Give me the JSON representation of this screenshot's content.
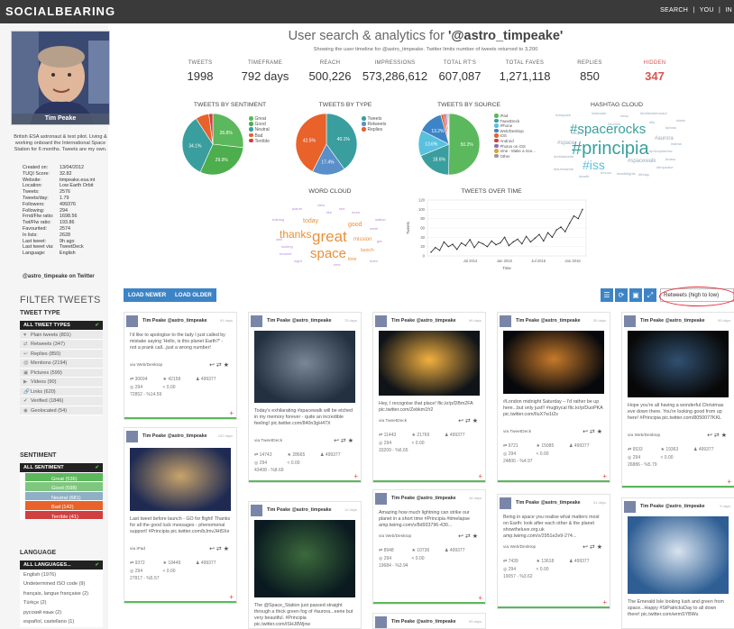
{
  "nav": {
    "logo": "SOCIALBEARING",
    "links": [
      "SEARCH",
      "|",
      "YOU",
      "|",
      "IN"
    ]
  },
  "profile": {
    "name": "Tim Peake",
    "bio": "British ESA astronaut & test pilot. Living & working onboard the International Space Station for 6 months. Tweets are my own.",
    "stats": [
      [
        "Created on:",
        "13/04/2012"
      ],
      [
        "TUQI Score:",
        "32.82"
      ],
      [
        "Website:",
        "timpeake.esa.int"
      ],
      [
        "Location:",
        "Low Earth Orbit"
      ],
      [
        "Tweets:",
        "2576"
      ],
      [
        "Tweets/day:",
        "1.79"
      ],
      [
        "Followers:",
        "499376"
      ],
      [
        "Following:",
        "294"
      ],
      [
        "Frnd/Flw ratio:",
        "1698.56"
      ],
      [
        "Twt/Flw ratio:",
        "193.86"
      ],
      [
        "Favourited:",
        "2574"
      ],
      [
        "In lists:",
        "2628"
      ],
      [
        "Last tweet:",
        "9h ago"
      ],
      [
        "Last tweet via:",
        "TweetDeck"
      ],
      [
        "Language:",
        "English"
      ]
    ],
    "handle_line": "@astro_timpeake on Twitter"
  },
  "filter": {
    "heading": "FILTER TWEETS",
    "type_title": "TWEET TYPE",
    "type": [
      "ALL TWEET TYPES",
      "Plain tweets (801)",
      "Retweets (347)",
      "Replies (850)",
      "Mentions (2194)",
      "Pictures (599)",
      "Videos (90)",
      "Links (620)",
      "Verified (1846)",
      "Geolocated (54)"
    ],
    "sent_title": "SENTIMENT",
    "sent": [
      "ALL SENTIMENT",
      "Great (536)",
      "Good (598)",
      "Neutral (681)",
      "Bad (142)",
      "Terrible (41)"
    ],
    "lang_title": "LANGUAGE",
    "lang": [
      "ALL LANGUAGES...",
      "English (1976)",
      "Undetermined ISO code (9)",
      "français, langue française (2)",
      "Türkçe (2)",
      "русский язык (2)",
      "español, castellano (1)"
    ]
  },
  "header": {
    "title_prefix": "User search & analytics for ",
    "title_user": "'@astro_timpeake'",
    "subtitle": "Showing the user timeline for @astro_timpeake. Twitter limits number of tweets returned to 3,200"
  },
  "metrics": [
    {
      "label": "TWEETS",
      "value": "1998"
    },
    {
      "label": "TIMEFRAME",
      "value": "792 days"
    },
    {
      "label": "REACH",
      "value": "500,226"
    },
    {
      "label": "IMPRESSIONS",
      "value": "573,286,612"
    },
    {
      "label": "TOTAL RT'S",
      "value": "607,087"
    },
    {
      "label": "TOTAL FAVES",
      "value": "1,271,118"
    },
    {
      "label": "REPLIES",
      "value": "850"
    },
    {
      "label": "HIDDEN",
      "value": "347"
    }
  ],
  "colors": {
    "accent": "#3d84c6",
    "hidden": "#d9534f",
    "great": "#5cb85c",
    "good": "#4cae4c",
    "neutral": "#3a9e9e",
    "bad": "#e8622a",
    "terrible": "#d04040"
  },
  "panels": {
    "sentiment": "TWEETS BY SENTIMENT",
    "type": "TWEETS BY TYPE",
    "source": "TWEETS BY SOURCE",
    "hashtag": "HASHTAG CLOUD",
    "word": "WORD CLOUD",
    "time": "TWEETS OVER TIME"
  },
  "chart_data": [
    {
      "type": "pie",
      "title": "TWEETS BY SENTIMENT",
      "labels": [
        "Great",
        "Good",
        "Neutral",
        "Bad",
        "Terrible"
      ],
      "values": [
        26.8,
        29.9,
        34.1,
        7.1,
        2.1
      ],
      "data_labels": [
        "26.8%",
        "29.9%",
        "34.1%"
      ],
      "colors": [
        "#5cb85c",
        "#4cae4c",
        "#3a9e9e",
        "#e8622a",
        "#d04040"
      ]
    },
    {
      "type": "pie",
      "title": "TWEETS BY TYPE",
      "labels": [
        "Tweets",
        "Retweets",
        "Replies"
      ],
      "values": [
        40.1,
        17.4,
        42.5
      ],
      "data_labels": [
        "40.1%",
        "17.4%",
        "42.5%"
      ],
      "colors": [
        "#3a9e9e",
        "#5b8fc9",
        "#e8622a"
      ]
    },
    {
      "type": "pie",
      "title": "TWEETS BY SOURCE",
      "labels": [
        "iPad",
        "TweetDeck",
        "iPhone",
        "Web/Desktop",
        "iOS",
        "Android",
        "Photos on iOS",
        "Vine - Make a Sce...",
        "Other"
      ],
      "values": [
        50.2,
        18.6,
        13.6,
        13.2,
        1.5,
        1.0,
        0.8,
        0.6,
        0.5
      ],
      "data_labels": [
        "50.2%",
        "18.6%",
        "13.6%",
        "13.2%"
      ],
      "colors": [
        "#5cb85c",
        "#3a9e9e",
        "#5bc0de",
        "#3d84c6",
        "#e8622a",
        "#d04040",
        "#8a6fb4",
        "#d9a440",
        "#999999"
      ]
    },
    {
      "type": "line",
      "title": "TWEETS OVER TIME",
      "ylabel": "Tweets",
      "xlabel": "Time",
      "yticks": [
        0,
        20,
        40,
        60,
        80,
        100,
        120
      ],
      "ylim": [
        0,
        120
      ],
      "xticks": [
        "Jul 2014",
        "Jan 2015",
        "Jul 2015",
        "Jan 2016"
      ],
      "values": [
        8,
        18,
        12,
        30,
        20,
        25,
        14,
        28,
        22,
        35,
        18,
        30,
        26,
        20,
        32,
        24,
        28,
        40,
        22,
        30,
        36,
        26,
        42,
        30,
        38,
        46,
        32,
        50,
        40,
        56,
        62,
        52,
        70,
        86,
        80,
        100
      ]
    }
  ],
  "hashtags": [
    {
      "t": "#spacerocks",
      "s": 15,
      "c": "#3a9e9e"
    },
    {
      "t": "#principia",
      "s": 20,
      "c": "#3a9e9e"
    },
    {
      "t": "#iss",
      "s": 14,
      "c": "#5bc0de"
    },
    {
      "t": "#aurora",
      "s": 6,
      "c": "#9ab"
    },
    {
      "t": "#space",
      "s": 6,
      "c": "#9ab"
    },
    {
      "t": "#spacewalk",
      "s": 6,
      "c": "#9ab"
    },
    {
      "t": "#esa",
      "s": 4,
      "c": "#9ab"
    },
    {
      "t": "#britishastronaut",
      "s": 4,
      "c": "#9ab"
    },
    {
      "t": "#orbitalearth",
      "s": 4,
      "c": "#9ab"
    },
    {
      "t": "#principiacrew",
      "s": 4,
      "c": "#9ab"
    },
    {
      "t": "#nasa",
      "s": 4,
      "c": "#9ab"
    },
    {
      "t": "#timpeake",
      "s": 4,
      "c": "#9ab"
    },
    {
      "t": "#friday",
      "s": 4,
      "c": "#9ab"
    },
    {
      "t": "#astrolab",
      "s": 4,
      "c": "#9ab"
    },
    {
      "t": "#earthlights",
      "s": 4,
      "c": "#9ab"
    },
    {
      "t": "#stinta",
      "s": 4,
      "c": "#9ab"
    },
    {
      "t": "#soyuz",
      "s": 4,
      "c": "#9ab"
    },
    {
      "t": "#bluemarble",
      "s": 4,
      "c": "#9ab"
    },
    {
      "t": "#photo",
      "s": 4,
      "c": "#9ab"
    },
    {
      "t": "#dark",
      "s": 4,
      "c": "#9ab"
    },
    {
      "t": "#sunset",
      "s": 4,
      "c": "#9ab"
    },
    {
      "t": "#ukspace",
      "s": 4,
      "c": "#9ab"
    },
    {
      "t": "#moon",
      "s": 4,
      "c": "#9ab"
    },
    {
      "t": "#earth",
      "s": 4,
      "c": "#9ab"
    },
    {
      "t": "#fly",
      "s": 4,
      "c": "#9ab"
    }
  ],
  "words": [
    {
      "t": "great",
      "s": 17,
      "c": "#e8913a"
    },
    {
      "t": "space",
      "s": 15,
      "c": "#e8913a"
    },
    {
      "t": "thanks",
      "s": 12,
      "c": "#e8913a"
    },
    {
      "t": "today",
      "s": 7,
      "c": "#e8913a"
    },
    {
      "t": "good",
      "s": 7,
      "c": "#e8913a"
    },
    {
      "t": "mission",
      "s": 6,
      "c": "#e8913a"
    },
    {
      "t": "launch",
      "s": 5,
      "c": "#e8913a"
    },
    {
      "t": "time",
      "s": 5,
      "c": "#e8913a"
    },
    {
      "t": "more",
      "s": 4,
      "c": "#b58adf"
    },
    {
      "t": "like",
      "s": 4,
      "c": "#b58adf"
    },
    {
      "t": "looking",
      "s": 4,
      "c": "#b58adf"
    },
    {
      "t": "forward",
      "s": 4,
      "c": "#b58adf"
    },
    {
      "t": "training",
      "s": 4,
      "c": "#b58adf"
    },
    {
      "t": "planet",
      "s": 4,
      "c": "#b58adf"
    },
    {
      "t": "earth",
      "s": 4,
      "c": "#b58adf"
    },
    {
      "t": "new",
      "s": 4,
      "c": "#b58adf"
    },
    {
      "t": "get",
      "s": 4,
      "c": "#b58adf"
    },
    {
      "t": "well",
      "s": 4,
      "c": "#b58adf"
    },
    {
      "t": "view",
      "s": 4,
      "c": "#b58adf"
    },
    {
      "t": "night",
      "s": 4,
      "c": "#b58adf"
    },
    {
      "t": "team",
      "s": 4,
      "c": "#b58adf"
    },
    {
      "t": "see",
      "s": 4,
      "c": "#b58adf"
    },
    {
      "t": "station",
      "s": 4,
      "c": "#b58adf"
    }
  ],
  "toolbar": {
    "newer": "LOAD NEWER",
    "older": "LOAD OLDER",
    "sort": "Retweets (high to low)",
    "icons": [
      "☰",
      "⟳",
      "▣",
      "⤢"
    ]
  },
  "tweets": [
    {
      "user": "Tim Peake @astro_timpeake",
      "days": "91 days",
      "text": "I'd like to apologise to the lady I just called by mistake saying 'Hello, is this planet Earth?' - not a prank call...just a wrong number!",
      "via": "via Web/Desktop",
      "rt": "30694",
      "fav": "42158",
      "fol": "499377",
      "fr": "294",
      "ratio": "0.00",
      "imp": "72852 - %14.59"
    },
    {
      "user": "Tim Peake @astro_timpeake",
      "days": "102 days",
      "text": "Last tweet before launch - GO for flight! Thanks for all the good luck messages - phenomenal support! #Principia pic.twitter.com/bJmvJHt5Xe",
      "via": "via iPad",
      "rt": "9372",
      "fav": "18449",
      "fol": "499377",
      "fr": "294",
      "ratio": "0.00",
      "imp": "27817 - %5.57"
    },
    {
      "user": "Tim Peake @astro_timpeake",
      "days": "75 days",
      "text": "Today's exhilarating #spacewalk will be etched in my memory forever - quite an incredible feeling! pic.twitter.com/840n3gH47X",
      "via": "via TweetDeck",
      "rt": "14743",
      "fav": "28665",
      "fol": "499377",
      "fr": "294",
      "ratio": "0.00",
      "imp": "43408 - %8.69"
    },
    {
      "user": "Tim Peake @astro_timpeake",
      "days": "12 days",
      "text": "The @Space_Station just passed straight through a thick green fog of #aurora...eerie but very beautiful. #Principia pic.twitter.com/iSHJ8Wjnw"
    },
    {
      "user": "Tim Peake @astro_timpeake",
      "days": "96 days",
      "text": "Hey, I recognise that place! flic.kr/p/DBm2FA pic.twitter.com/Zebkm1fr2",
      "via": "via TweetDeck",
      "rt": "11443",
      "fav": "21769",
      "fol": "499377",
      "fr": "294",
      "ratio": "0.00",
      "imp": "33209 - %6.65"
    },
    {
      "user": "Tim Peake @astro_timpeake",
      "days": "46 days",
      "text": "Amazing how much lightning can strike our planet in a short time #Principia #timelapse amp.twimg.com/v/8d933796-430...",
      "via": "via Web/Desktop",
      "rt": "8948",
      "fav": "10736",
      "fol": "499377",
      "fr": "294",
      "ratio": "0.00",
      "imp": "19684 - %3.94"
    },
    {
      "user": "Tim Peake @astro_timpeake",
      "days": "99 days",
      "text": ""
    },
    {
      "user": "Tim Peake @astro_timpeake",
      "days": "55 days",
      "text": "#London midnight Saturday – I'd rather be up here...but only just!! #rugbycal flic.kr/p/DuoPKA pic.twitter.com/lIuX7w1t2s",
      "via": "via TweetDeck",
      "rt": "9721",
      "fav": "15085",
      "fol": "499377",
      "fr": "294",
      "ratio": "0.00",
      "imp": "24806 - %4.97"
    },
    {
      "user": "Tim Peake @astro_timpeake",
      "days": "41 days",
      "text": "Being in space you realise what matters most on Earth: look after each other & the planet showtheluve.org.uk amp.twimg.com/v/2951e2e9-274...",
      "via": "via Web/Desktop",
      "rt": "7439",
      "fav": "13618",
      "fol": "499377",
      "fr": "294",
      "ratio": "0.00",
      "imp": "19057 - %3.62"
    },
    {
      "user": "Tim Peake @astro_timpeake",
      "days": "93 days",
      "text": "Hope you're all having a wonderful Christmas eve down there. You're looking good from up here! #Principia pic.twitter.com/8050077KKL",
      "via": "via Web/Desktop",
      "rt": "6533",
      "fav": "19363",
      "fol": "499377",
      "fr": "294",
      "ratio": "0.00",
      "imp": "26886 - %5.79"
    },
    {
      "user": "Tim Peake @astro_timpeake",
      "days": "9 days",
      "text": "The Emerald Isle looking lush and green from space...Happy #StPatricksDay to all down there! pic.twitter.com/wrmSYBWu"
    }
  ]
}
